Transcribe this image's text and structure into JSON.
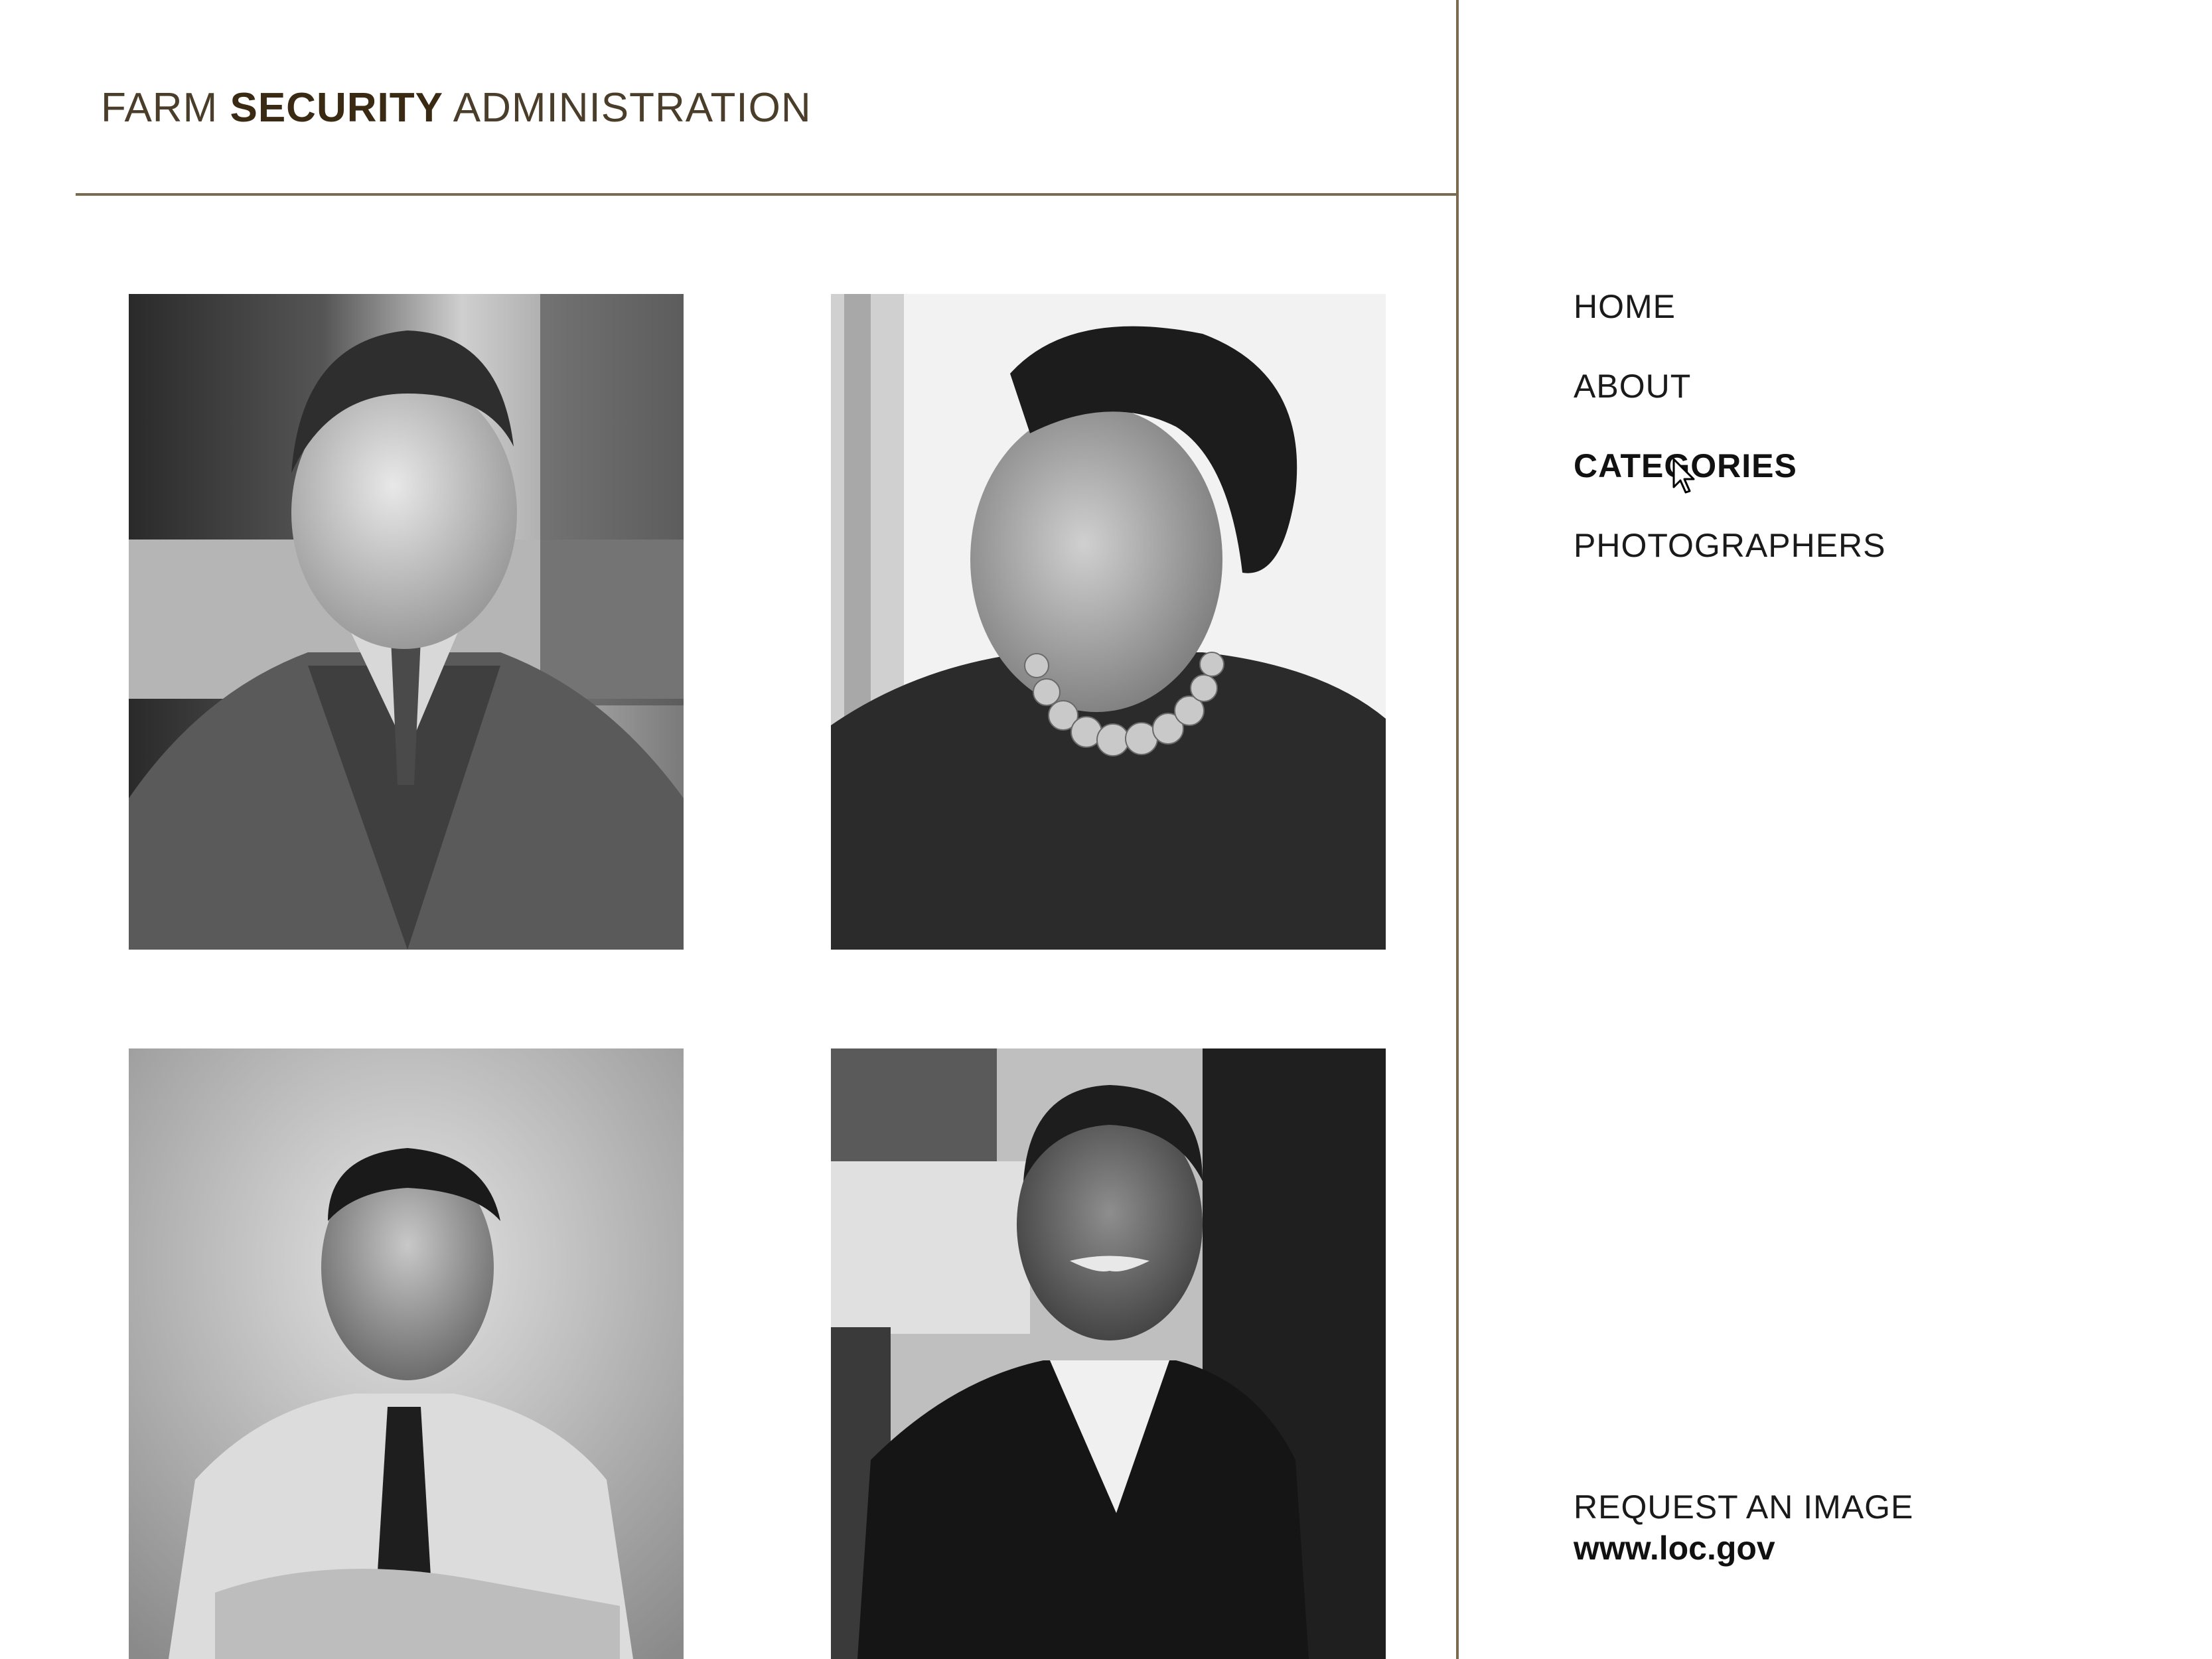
{
  "header": {
    "title_part1": "FARM",
    "title_part2": "SECURITY",
    "title_part3": "ADMINISTRATION"
  },
  "nav": {
    "items": [
      {
        "label": "HOME",
        "active": false
      },
      {
        "label": "ABOUT",
        "active": false
      },
      {
        "label": "CATEGORIES",
        "active": true
      },
      {
        "label": "PHOTOGRAPHERS",
        "active": false
      }
    ]
  },
  "footer": {
    "request_label": "REQUEST AN IMAGE",
    "url": "www.loc.gov"
  },
  "photos": [
    {
      "name": "portrait-young-man-suit"
    },
    {
      "name": "portrait-woman-beret-pearls"
    },
    {
      "name": "portrait-young-man-tie"
    },
    {
      "name": "portrait-smiling-man-jacket"
    }
  ],
  "colors": {
    "rule": "#7a6a50",
    "title": "#4a3d2a",
    "text": "#1a1a1a"
  }
}
